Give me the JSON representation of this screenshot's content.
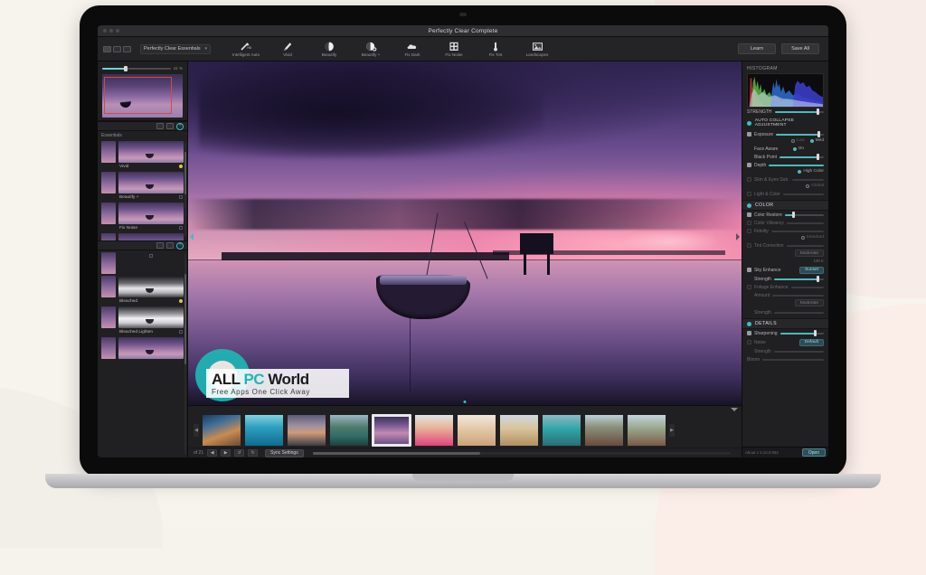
{
  "window": {
    "title": "Perfectly Clear Complete"
  },
  "toolbar": {
    "preset_select": "Perfectly Clear Essentials",
    "chevron": "▾",
    "tools": [
      {
        "label": "Intelligent Auto",
        "icon": "magic-wand-icon"
      },
      {
        "label": "Vivid",
        "icon": "brush-icon"
      },
      {
        "label": "Beautify",
        "icon": "face-icon"
      },
      {
        "label": "Beautify +",
        "icon": "face-plus-icon"
      },
      {
        "label": "Fix Dark",
        "icon": "cloud-icon"
      },
      {
        "label": "Fix Noise",
        "icon": "grid-icon"
      },
      {
        "label": "Fix Tint",
        "icon": "thermometer-icon"
      },
      {
        "label": "Landscapes",
        "icon": "landscape-icon"
      }
    ],
    "learn_label": "Learn",
    "save_all_label": "Save All"
  },
  "navigator": {
    "zoom_value": "41 %"
  },
  "presets_panel_1": {
    "group_label": "Essentials",
    "items": [
      {
        "name": "Vivid",
        "marker": "active"
      },
      {
        "name": "Beautify +",
        "marker": "none"
      },
      {
        "name": "Fix Noise",
        "marker": "none"
      }
    ]
  },
  "presets_panel_2": {
    "items": [
      {
        "name": "Bleached",
        "marker": "active"
      },
      {
        "name": "Bleached Lighten",
        "marker": "none"
      }
    ]
  },
  "right_panel": {
    "histogram_label": "HISTOGRAM",
    "strength_label": "STRENGTH",
    "auto_collapse_label": "AUTO COLLAPSE ADJUSTMENT",
    "sections": [
      {
        "name": "",
        "rows": [
          {
            "label": "Exposure",
            "type": "slider",
            "checked": true,
            "enabled": true,
            "fill": 88
          },
          {
            "label": "",
            "type": "radios",
            "options": [
              "Low",
              "Med"
            ],
            "selected": "Med"
          },
          {
            "label": "Face Aware",
            "type": "radio-on",
            "value": "On"
          },
          {
            "label": "Black Point",
            "type": "slider",
            "checked": false,
            "enabled": true,
            "fill": 86
          },
          {
            "label": "Depth",
            "type": "slider",
            "checked": true,
            "enabled": true,
            "fill": 100
          },
          {
            "label": "",
            "type": "pill",
            "value": "High Color"
          },
          {
            "label": "Skin & Eyes Sub.",
            "type": "slider",
            "checked": false,
            "enabled": false,
            "fill": 0
          },
          {
            "label": "",
            "type": "pill-dim",
            "value": "Global"
          },
          {
            "label": "Light & Color",
            "type": "slider",
            "checked": false,
            "enabled": false,
            "fill": 0
          }
        ]
      },
      {
        "name": "COLOR",
        "rows": [
          {
            "label": "Color Restore",
            "type": "slider",
            "checked": true,
            "enabled": true,
            "fill": 22
          },
          {
            "label": "Color Vibrancy",
            "type": "slider",
            "checked": false,
            "enabled": false,
            "fill": 0
          },
          {
            "label": "Fidelity",
            "type": "slider",
            "checked": false,
            "enabled": false,
            "fill": 0
          },
          {
            "label": "",
            "type": "pill-dim",
            "value": "Standard"
          },
          {
            "label": "Tint Correction",
            "type": "slider",
            "checked": false,
            "enabled": false,
            "fill": 0
          },
          {
            "label": "",
            "type": "pill-dim",
            "value": "Moderate"
          },
          {
            "label": "100 K",
            "type": "note"
          },
          {
            "label": "Sky Enhance",
            "type": "pill",
            "checked": true,
            "value": "Sunset"
          },
          {
            "label": "Strength",
            "type": "slider",
            "checked": false,
            "enabled": true,
            "fill": 88,
            "indent": true
          },
          {
            "label": "Foliage Enhance",
            "type": "slider",
            "checked": false,
            "enabled": false,
            "fill": 0
          },
          {
            "label": "Amount",
            "type": "slider",
            "checked": false,
            "enabled": false,
            "fill": 0,
            "indent": true
          },
          {
            "label": "",
            "type": "pill-dim",
            "value": "Moderate"
          },
          {
            "label": "Strength",
            "type": "slider",
            "checked": false,
            "enabled": false,
            "fill": 0,
            "indent": true
          }
        ]
      },
      {
        "name": "DETAILS",
        "rows": [
          {
            "label": "Sharpening",
            "type": "slider",
            "checked": true,
            "enabled": true,
            "fill": 80
          },
          {
            "label": "Noise",
            "type": "pill",
            "checked": false,
            "value": "Default"
          },
          {
            "label": "Strength",
            "type": "slider",
            "checked": false,
            "enabled": false,
            "fill": 0,
            "indent": true
          },
          {
            "label": "Bloom",
            "type": "slider",
            "checked": false,
            "enabled": false,
            "fill": 0
          }
        ]
      }
    ],
    "version": "About v 3.10.0.064",
    "open_label": "Open"
  },
  "filmstrip": {
    "count_label": "of 21",
    "prev_icon": "◀",
    "next_icon": "▶",
    "rotate_left_icon": "↺",
    "rotate_right_icon": "↻",
    "sync_label": "Sync Settings",
    "thumbs": [
      {
        "name": "pier-sunset",
        "selected": false
      },
      {
        "name": "dolphin-sea",
        "selected": false
      },
      {
        "name": "rocky-coast",
        "selected": false
      },
      {
        "name": "mountain-lake",
        "selected": false
      },
      {
        "name": "boat-sunset",
        "selected": true
      },
      {
        "name": "portrait-pink",
        "selected": false
      },
      {
        "name": "portrait-blonde",
        "selected": false
      },
      {
        "name": "beach-dunes",
        "selected": false
      },
      {
        "name": "turquoise-bay",
        "selected": false
      },
      {
        "name": "village-roofs",
        "selected": false
      },
      {
        "name": "harbor-town",
        "selected": false
      }
    ]
  },
  "watermark": {
    "title_all": "ALL ",
    "title_pc": "PC",
    "title_world": " World",
    "subtitle": "Free Apps One Click Away"
  },
  "colors": {
    "accent": "#3bbfc4",
    "slider_fill": "#4fb8bd",
    "panel_bg": "#202022",
    "app_bg": "#1c1c1e"
  }
}
